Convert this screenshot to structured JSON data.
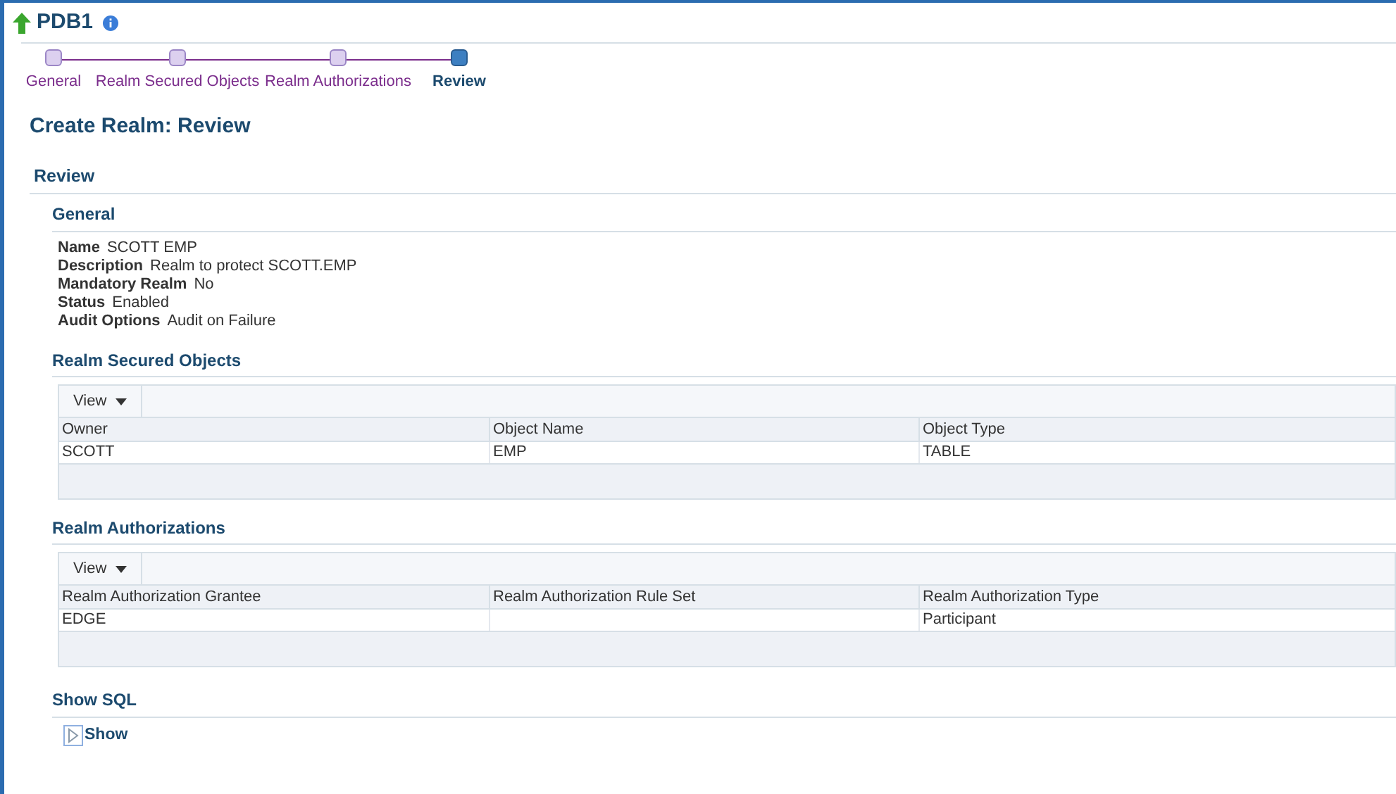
{
  "header": {
    "title": "PDB1"
  },
  "train": [
    {
      "label": "General",
      "selected": false
    },
    {
      "label": "Realm Secured Objects",
      "selected": false
    },
    {
      "label": "Realm Authorizations",
      "selected": false
    },
    {
      "label": "Review",
      "selected": true
    }
  ],
  "page_title": "Create Realm: Review",
  "section_title": "Review",
  "general": {
    "title": "General",
    "fields": [
      {
        "label": "Name",
        "value": "SCOTT EMP"
      },
      {
        "label": "Description",
        "value": "Realm to protect SCOTT.EMP"
      },
      {
        "label": "Mandatory Realm",
        "value": "No"
      },
      {
        "label": "Status",
        "value": "Enabled"
      },
      {
        "label": "Audit Options",
        "value": "Audit on Failure"
      }
    ]
  },
  "tables": [
    {
      "title": "Realm Secured Objects",
      "view_button": "View",
      "columns": [
        "Owner",
        "Object Name",
        "Object Type"
      ],
      "rows": [
        [
          "SCOTT",
          "EMP",
          "TABLE"
        ]
      ]
    },
    {
      "title": "Realm Authorizations",
      "view_button": "View",
      "columns": [
        "Realm Authorization Grantee",
        "Realm Authorization Rule Set",
        "Realm Authorization Type"
      ],
      "rows": [
        [
          "EDGE",
          "",
          "Participant"
        ]
      ]
    }
  ],
  "show_sql": {
    "title": "Show SQL",
    "link": "Show"
  }
}
